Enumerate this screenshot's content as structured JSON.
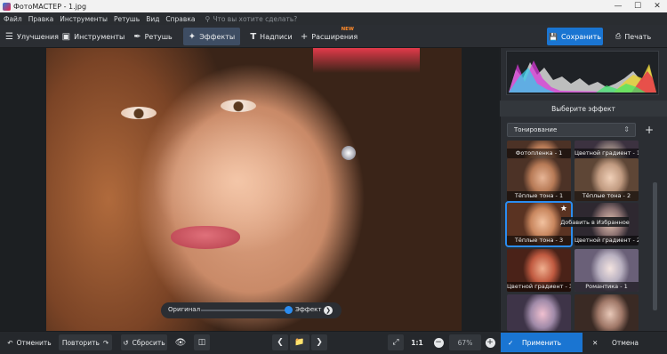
{
  "window": {
    "title": "ФотоМАСТЕР - 1.jpg",
    "controls": [
      "—",
      "☐",
      "✕"
    ]
  },
  "menu": {
    "items": [
      "Файл",
      "Правка",
      "Инструменты",
      "Ретушь",
      "Вид",
      "Справка"
    ],
    "search_placeholder": "Что вы хотите сделать?"
  },
  "toolbar": {
    "tabs": [
      {
        "label": "Улучшения",
        "icon": "sliders-icon"
      },
      {
        "label": "Инструменты",
        "icon": "crop-icon"
      },
      {
        "label": "Ретушь",
        "icon": "brush-icon"
      },
      {
        "label": "Эффекты",
        "icon": "magic-wand-icon",
        "active": true
      },
      {
        "label": "Надписи",
        "icon": "text-icon"
      },
      {
        "label": "Расширения",
        "icon": "plus-icon",
        "badge": "NEW"
      }
    ],
    "save_label": "Сохранить",
    "print_label": "Печать"
  },
  "compare": {
    "left_label": "Оригинал",
    "right_label": "Эффект",
    "position": 0.94
  },
  "panel": {
    "header": "Выберите эффект",
    "category": "Тонирование",
    "thumbnails": [
      {
        "label": "Фотопленка - 1"
      },
      {
        "label": "Цветной градиент - 1"
      },
      {
        "label": "Тёплые тона - 1"
      },
      {
        "label": "Тёплые тона - 2"
      },
      {
        "label": "Тёплые тона - 3",
        "selected": true
      },
      {
        "label": "Цветной градиент - 2"
      },
      {
        "label": "Цветной градиент - 3"
      },
      {
        "label": "Романтика - 1"
      },
      {
        "label": ""
      },
      {
        "label": ""
      }
    ],
    "tooltip": "Добавить в Избранное",
    "apply_label": "Применить",
    "cancel_label": "Отмена"
  },
  "bottom": {
    "undo_label": "Отменить",
    "redo_label": "Повторить",
    "reset_label": "Сбросить",
    "ratio_label": "1:1",
    "zoom": "67%"
  },
  "colors": {
    "accent": "#1a75d2",
    "panel": "#2b2e33",
    "background": "#1e2124"
  }
}
